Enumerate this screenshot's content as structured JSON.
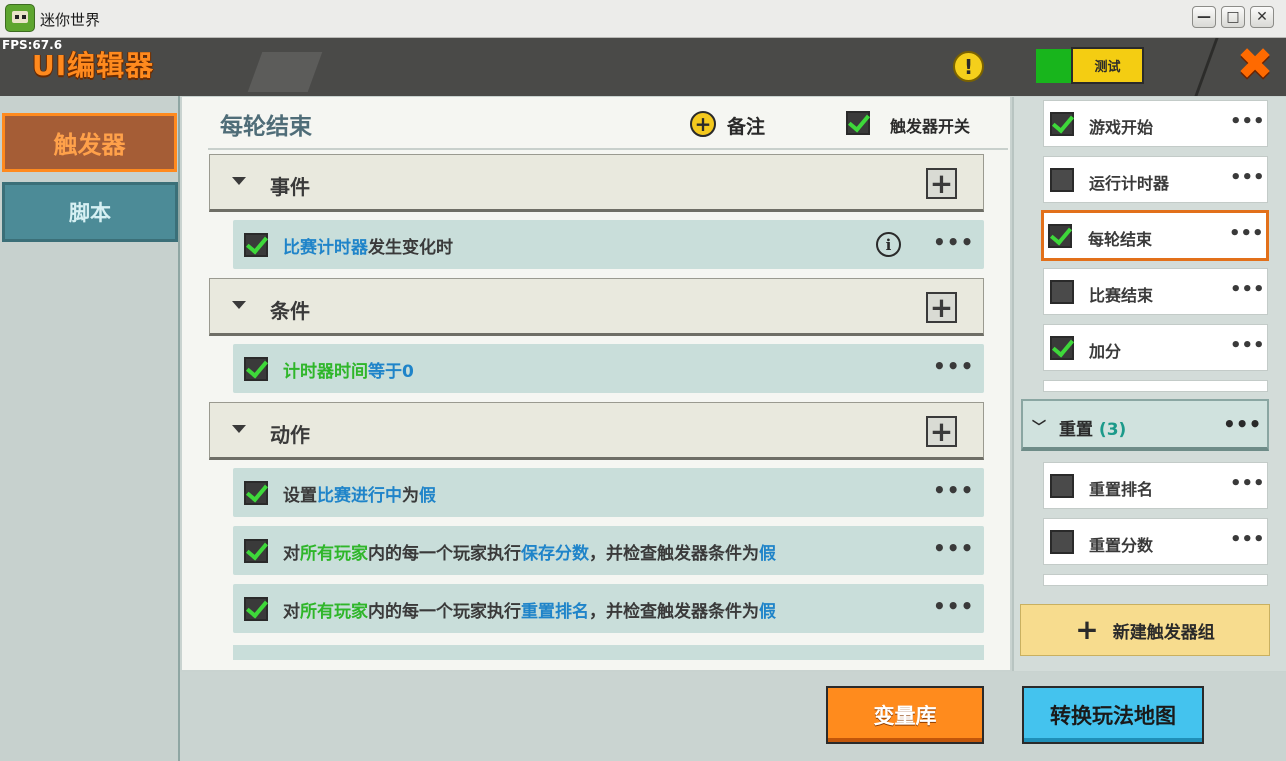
{
  "window": {
    "title": "迷你世界",
    "minimize": "—",
    "maximize": "□",
    "close": "✕"
  },
  "header": {
    "fps": "FPS:67.6",
    "title": "UI编辑器",
    "warning_symbol": "!",
    "test_label": "测试",
    "close_symbol": "✖"
  },
  "sidebar": {
    "tabs": [
      {
        "label": "触发器",
        "active": true
      },
      {
        "label": "脚本",
        "active": false
      }
    ]
  },
  "trigger": {
    "name": "每轮结束",
    "note_symbol": "+",
    "note_label": "备注",
    "switch_label": "触发器开关",
    "switch_on": true
  },
  "sections": {
    "event": {
      "label": "事件",
      "rows": [
        {
          "checked": true,
          "parts": [
            {
              "t": "比赛计时器",
              "c": "blue"
            },
            {
              "t": "发生变化时",
              "c": "plain"
            }
          ],
          "info": "i"
        }
      ]
    },
    "condition": {
      "label": "条件",
      "rows": [
        {
          "checked": true,
          "parts": [
            {
              "t": "计时器时间",
              "c": "green"
            },
            {
              "t": "等于",
              "c": "blue"
            },
            {
              "t": "0",
              "c": "blue"
            }
          ]
        }
      ]
    },
    "action": {
      "label": "动作",
      "rows": [
        {
          "checked": true,
          "parts": [
            {
              "t": "设置",
              "c": "plain"
            },
            {
              "t": "比赛进行中",
              "c": "blue"
            },
            {
              "t": "为",
              "c": "plain"
            },
            {
              "t": "假",
              "c": "blue"
            }
          ]
        },
        {
          "checked": true,
          "parts": [
            {
              "t": "对",
              "c": "plain"
            },
            {
              "t": "所有玩家",
              "c": "green"
            },
            {
              "t": "内的每一个玩家执行",
              "c": "plain"
            },
            {
              "t": "保存分数",
              "c": "blue"
            },
            {
              "t": "，并检查触发器条件为",
              "c": "plain"
            },
            {
              "t": "假",
              "c": "blue"
            }
          ]
        },
        {
          "checked": true,
          "parts": [
            {
              "t": "对",
              "c": "plain"
            },
            {
              "t": "所有玩家",
              "c": "green"
            },
            {
              "t": "内的每一个玩家执行",
              "c": "plain"
            },
            {
              "t": "重置排名",
              "c": "blue"
            },
            {
              "t": "，并检查触发器条件为",
              "c": "plain"
            },
            {
              "t": "假",
              "c": "blue"
            }
          ]
        }
      ]
    },
    "more_symbol": "•••",
    "plus_symbol": "+"
  },
  "right_panel": {
    "items": [
      {
        "label": "游戏开始",
        "checked": true
      },
      {
        "label": "运行计时器",
        "checked": false
      },
      {
        "label": "每轮结束",
        "checked": true,
        "selected": true
      },
      {
        "label": "比赛结束",
        "checked": false
      },
      {
        "label": "加分",
        "checked": true
      }
    ],
    "group": {
      "chevron": "﹀",
      "label": "重置",
      "count": "(3)"
    },
    "group_items": [
      {
        "label": "重置排名",
        "checked": false
      },
      {
        "label": "重置分数",
        "checked": false
      }
    ],
    "new_group_symbol": "+",
    "new_group_label": "新建触发器组"
  },
  "footer": {
    "variables_label": "变量库",
    "convert_label": "转换玩法地图"
  },
  "colors": {
    "accent_orange": "#ff8b1d",
    "accent_blue": "#44c3ee",
    "highlight_blue": "#1f84c9",
    "highlight_green": "#2fb62a",
    "check_green": "#3ed83a"
  }
}
